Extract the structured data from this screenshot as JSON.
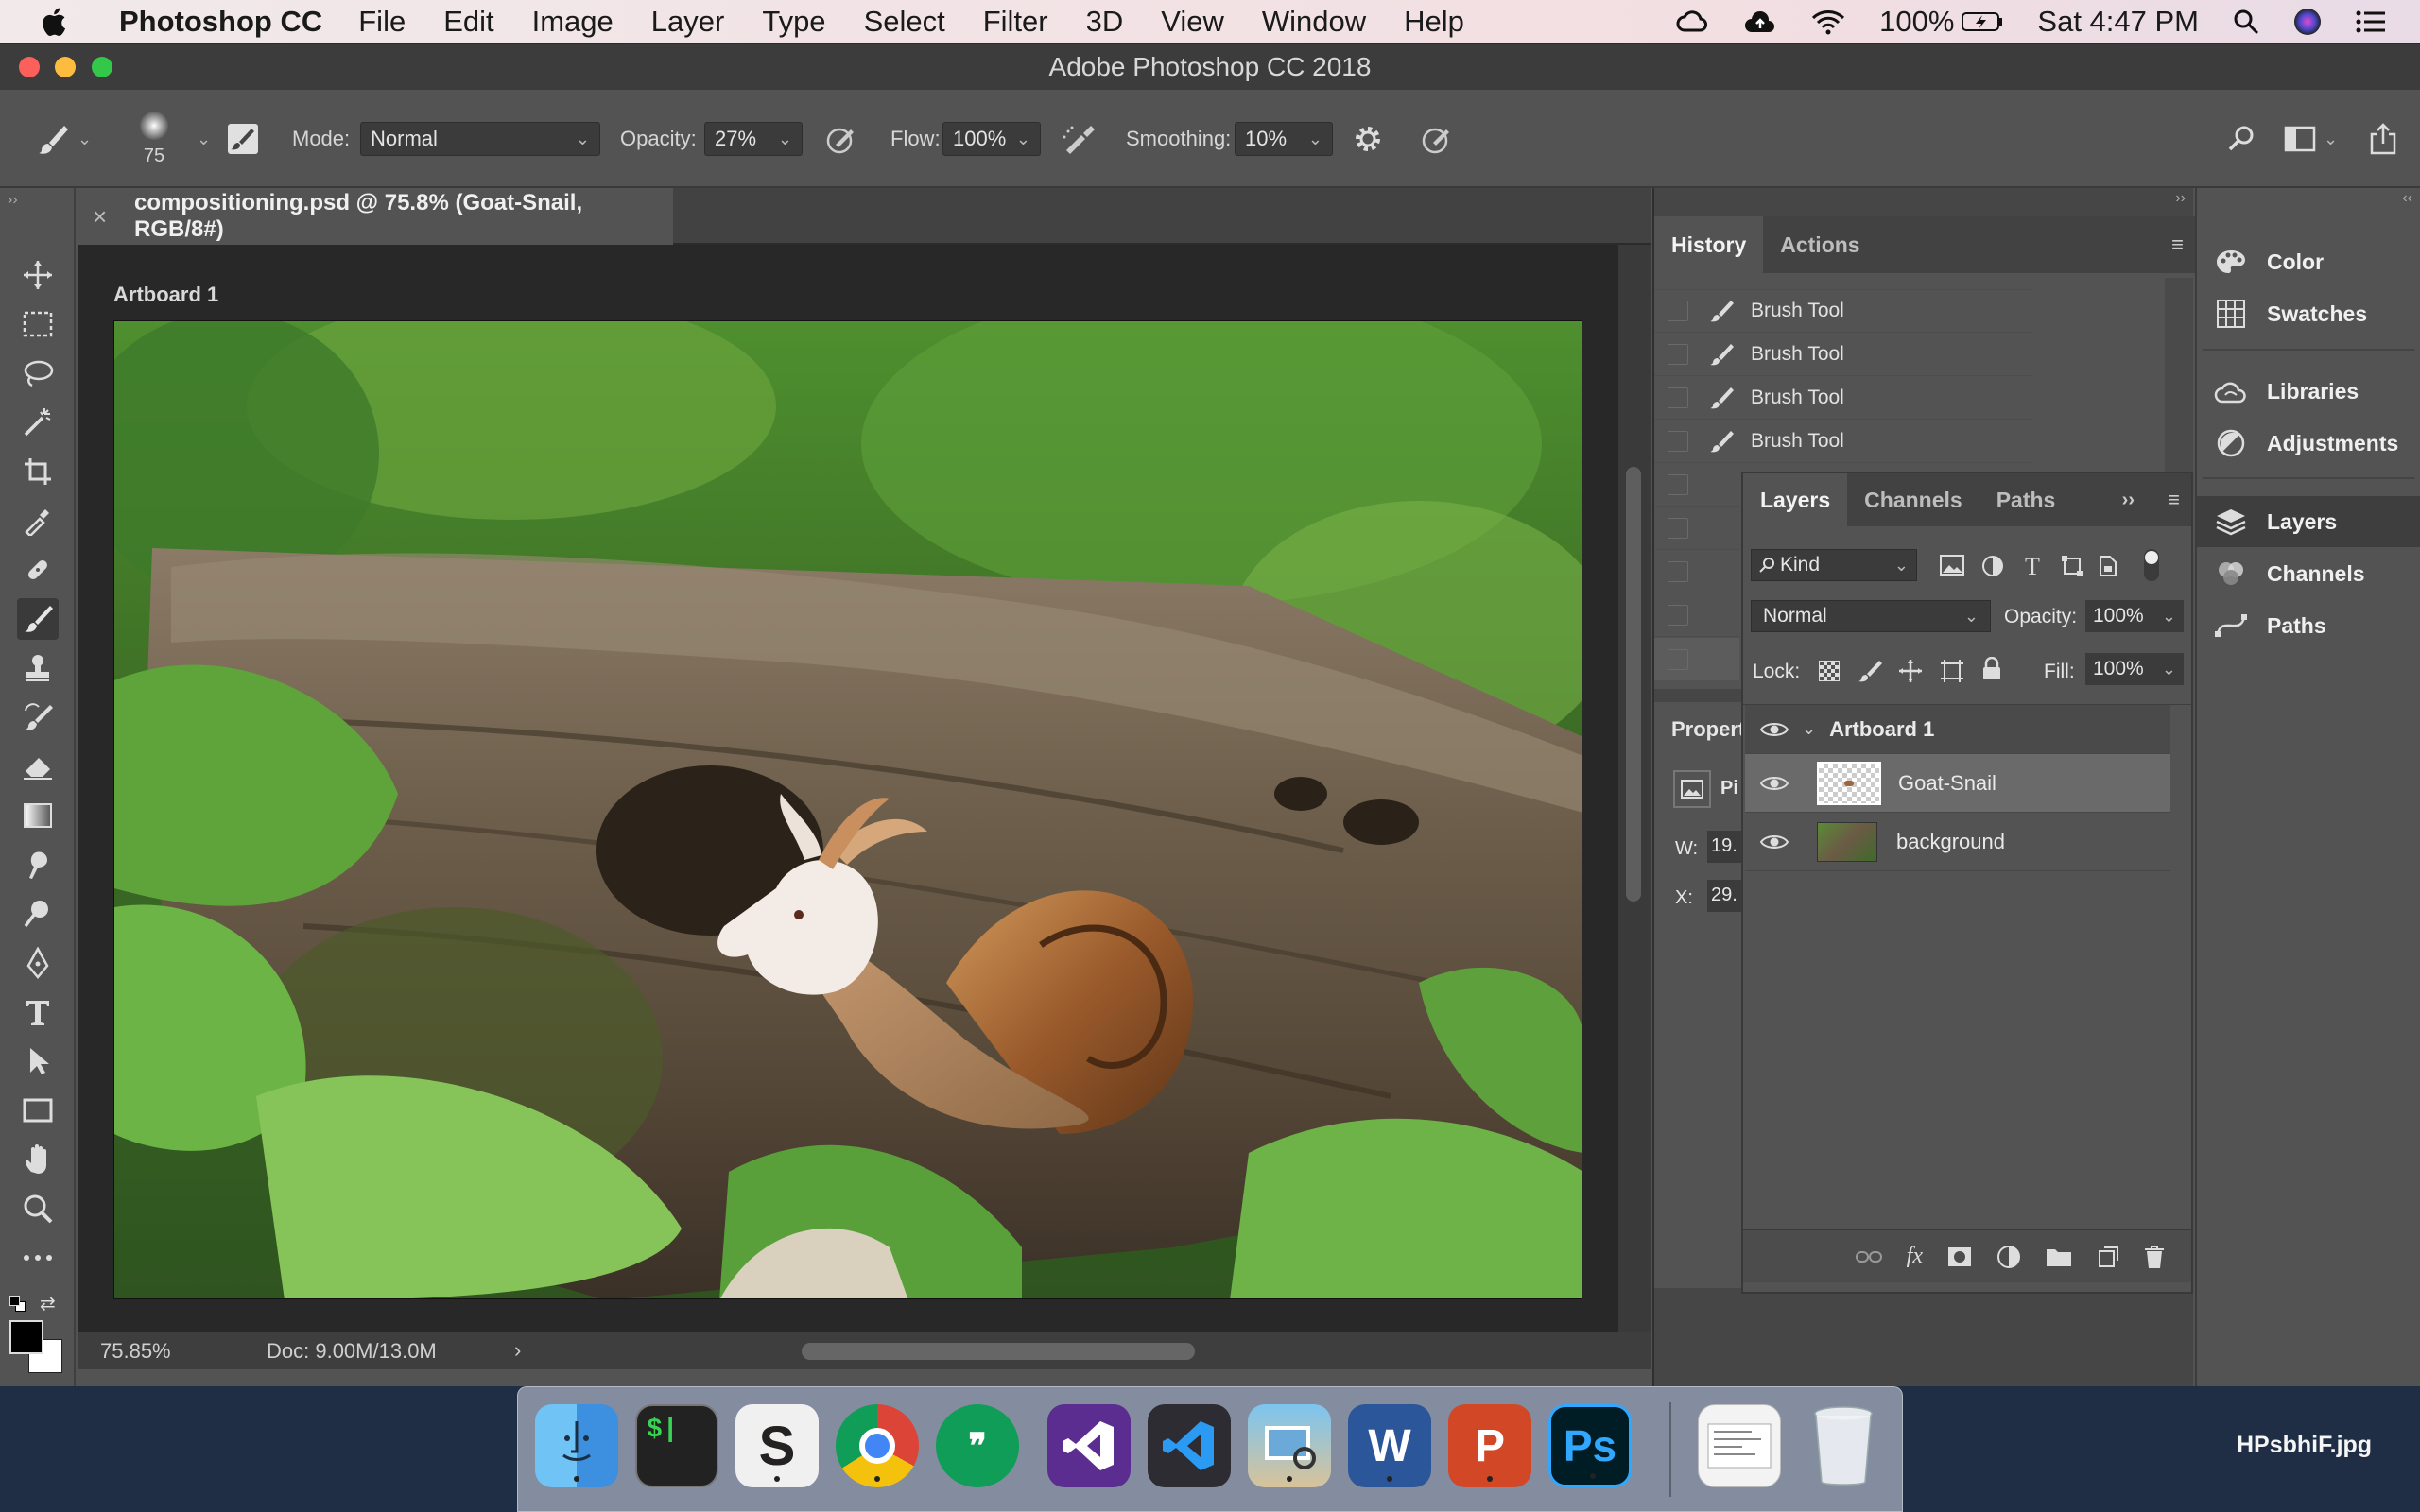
{
  "menubar": {
    "app_name": "Photoshop CC",
    "items": [
      "File",
      "Edit",
      "Image",
      "Layer",
      "Type",
      "Select",
      "Filter",
      "3D",
      "View",
      "Window",
      "Help"
    ],
    "battery": "100%",
    "clock": "Sat 4:47 PM"
  },
  "window": {
    "title": "Adobe Photoshop CC 2018"
  },
  "options_bar": {
    "brush_size": "75",
    "mode_label": "Mode:",
    "mode_value": "Normal",
    "opacity_label": "Opacity:",
    "opacity_value": "27%",
    "flow_label": "Flow:",
    "flow_value": "100%",
    "smoothing_label": "Smoothing:",
    "smoothing_value": "10%"
  },
  "document": {
    "tab_title": "compositioning.psd @ 75.8% (Goat-Snail, RGB/8#)",
    "artboard_label": "Artboard 1",
    "zoom": "75.85%",
    "doc_size": "Doc: 9.00M/13.0M"
  },
  "history_panel": {
    "tabs": [
      "History",
      "Actions"
    ],
    "rows": [
      "Brush Tool",
      "Brush Tool",
      "Brush Tool",
      "Brush Tool"
    ]
  },
  "properties_panel": {
    "title": "Propert",
    "w_label": "W:",
    "w_value": "19.",
    "x_label": "X:",
    "x_value": "29.",
    "px_label": "Pi"
  },
  "layers_panel": {
    "tabs": [
      "Layers",
      "Channels",
      "Paths"
    ],
    "filter_label": "Kind",
    "blend_mode": "Normal",
    "opacity_label": "Opacity:",
    "opacity_value": "100%",
    "lock_label": "Lock:",
    "fill_label": "Fill:",
    "fill_value": "100%",
    "group_name": "Artboard 1",
    "layers": [
      {
        "name": "Goat-Snail",
        "selected": true
      },
      {
        "name": "background",
        "selected": false
      }
    ]
  },
  "dock_panels": [
    "Color",
    "Swatches",
    "Libraries",
    "Adjustments",
    "Layers",
    "Channels",
    "Paths"
  ],
  "dock": {
    "apps": [
      "Finder",
      "Terminal",
      "Slack",
      "Chrome",
      "Hangouts",
      "Visual Studio",
      "VS Code",
      "Preview",
      "Word",
      "PowerPoint",
      "Photoshop",
      "Document",
      "Trash"
    ]
  },
  "desktop_file": "HPsbhiF.jpg",
  "colors": {
    "accent_blue": "#31a8ff",
    "panel_bg": "#535353",
    "canvas_bg": "#282828"
  }
}
